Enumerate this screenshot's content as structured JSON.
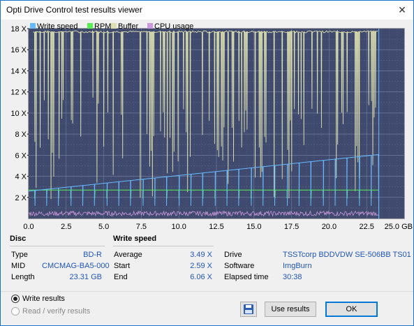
{
  "window": {
    "title": "Opti Drive Control test results viewer",
    "close_glyph": "✕"
  },
  "chart_data": {
    "type": "line",
    "legend": [
      "Write speed",
      "RPM",
      "Buffer",
      "CPU usage"
    ],
    "legend_colors": [
      "#66bbff",
      "#55ee55",
      "#dde0b0",
      "#cc99dd"
    ],
    "y_ticks": [
      "18 X",
      "16 X",
      "14 X",
      "12 X",
      "10 X",
      "8 X",
      "6 X",
      "4 X",
      "2 X"
    ],
    "y_tick_values": [
      18,
      16,
      14,
      12,
      10,
      8,
      6,
      4,
      2
    ],
    "x_ticks": [
      "0.0",
      "2.5",
      "5.0",
      "7.5",
      "10.0",
      "12.5",
      "15.0",
      "17.5",
      "20.0",
      "22.5",
      "25.0 GB"
    ],
    "x_tick_values": [
      0,
      2.5,
      5,
      7.5,
      10,
      12.5,
      15,
      17.5,
      20,
      22.5,
      25
    ],
    "xlim": [
      0,
      25
    ],
    "ylim": [
      0,
      18
    ],
    "series": [
      {
        "name": "Write speed",
        "color": "#66bbff",
        "x": [
          0,
          23.31
        ],
        "values": [
          2.59,
          6.06
        ]
      },
      {
        "name": "RPM",
        "color": "#55ee55",
        "x": [
          0,
          23.31
        ],
        "values": [
          2.7,
          2.7
        ]
      },
      {
        "name": "Buffer",
        "color": "#dde0b0",
        "x": [
          0,
          23.31
        ],
        "values": [
          17.7,
          17.7
        ]
      },
      {
        "name": "CPU usage",
        "color": "#cc99dd",
        "x": [
          0,
          23.31
        ],
        "values": [
          0.4,
          0.4
        ]
      }
    ],
    "background": "#3f4a6e",
    "grid": true
  },
  "disc": {
    "header": "Disc",
    "type_label": "Type",
    "type_value": "BD-R",
    "mid_label": "MID",
    "mid_value": "CMCMAG-BA5-000",
    "length_label": "Length",
    "length_value": "23.31 GB"
  },
  "write_speed": {
    "header": "Write speed",
    "average_label": "Average",
    "average_value": "3.49 X",
    "start_label": "Start",
    "start_value": "2.59 X",
    "end_label": "End",
    "end_value": "6.06 X"
  },
  "drive_info": {
    "drive_label": "Drive",
    "drive_value": "TSSTcorp  BDDVDW SE-506BB TS01",
    "software_label": "Software",
    "software_value": "ImgBurn",
    "elapsed_label": "Elapsed time",
    "elapsed_value": "30:38"
  },
  "bottom": {
    "write_results": "Write results",
    "read_verify_results": "Read / verify results",
    "use_results": "Use results",
    "ok": "OK"
  }
}
